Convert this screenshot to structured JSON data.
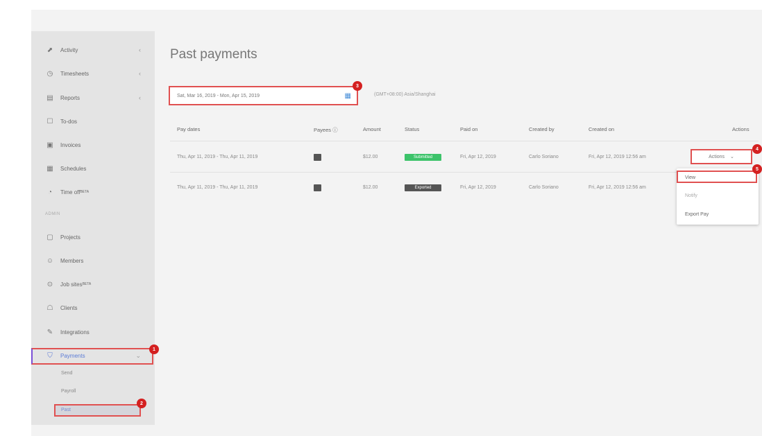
{
  "page": {
    "title": "Past payments",
    "date_range": "Sat, Mar 16, 2019 - Mon, Apr 15, 2019",
    "timezone": "(GMT+08:00) Asia/Shanghai"
  },
  "sidebar": {
    "items": [
      {
        "icon": "activity-icon",
        "label": "Activity",
        "chevron": "‹"
      },
      {
        "icon": "timesheets-icon",
        "label": "Timesheets",
        "chevron": "‹"
      },
      {
        "icon": "reports-icon",
        "label": "Reports",
        "chevron": "‹"
      },
      {
        "icon": "todos-icon",
        "label": "To-dos"
      },
      {
        "icon": "invoices-icon",
        "label": "Invoices"
      },
      {
        "icon": "schedules-icon",
        "label": "Schedules"
      },
      {
        "icon": "timeoff-icon",
        "label": "Time off",
        "beta": "BETA"
      }
    ],
    "section_label": "ADMIN",
    "admin_items": [
      {
        "icon": "projects-icon",
        "label": "Projects"
      },
      {
        "icon": "members-icon",
        "label": "Members"
      },
      {
        "icon": "job-sites-icon",
        "label": "Job sites",
        "beta": "BETA"
      },
      {
        "icon": "clients-icon",
        "label": "Clients"
      },
      {
        "icon": "integrations-icon",
        "label": "Integrations"
      },
      {
        "icon": "payments-icon",
        "label": "Payments",
        "chevron": "⌄"
      }
    ],
    "sub_items": [
      "Send",
      "Payroll",
      "Past"
    ]
  },
  "table": {
    "headers": [
      "Pay dates",
      "Payees",
      "Amount",
      "Status",
      "Paid on",
      "Created by",
      "Created on",
      "Actions"
    ],
    "rows": [
      {
        "pay_dates": "Thu, Apr 11, 2019 - Thu, Apr 11, 2019",
        "amount": "$12.00",
        "status": "Submitted",
        "status_color": "#3cc36a",
        "paid_on": "Fri, Apr 12, 2019",
        "created_by": "Carlo Soriano",
        "created_on": "Fri, Apr 12, 2019 12:56 am"
      },
      {
        "pay_dates": "Thu, Apr 11, 2019 - Thu, Apr 11, 2019",
        "amount": "$12.00",
        "status": "Exported",
        "status_color": "#555555",
        "paid_on": "Fri, Apr 12, 2019",
        "created_by": "Carlo Soriano",
        "created_on": "Fri, Apr 12, 2019 12:56 am"
      }
    ]
  },
  "actions": {
    "button_label": "Actions",
    "menu": [
      "View",
      "Notify",
      "Export Pay"
    ]
  },
  "annotations": {
    "badges": [
      "1",
      "2",
      "3",
      "4",
      "5"
    ],
    "color": "#d42020"
  }
}
